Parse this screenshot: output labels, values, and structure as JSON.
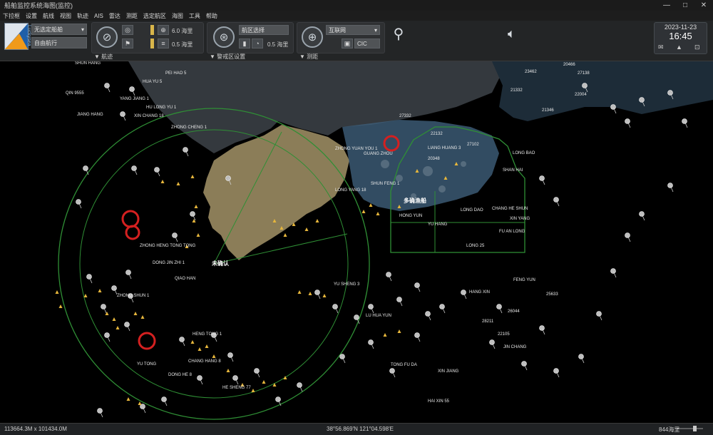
{
  "window": {
    "title": "船舶监控系统海图(监控)",
    "controls": [
      "—",
      "□",
      "✕"
    ]
  },
  "menu": [
    "下拉框",
    "设置",
    "航线",
    "视图",
    "轨迹",
    "AIS",
    "雷达",
    "测距",
    "选定航区",
    "海图",
    "工具",
    "帮助"
  ],
  "toolbar": {
    "logo_text": "Luckysea",
    "ship_select": "无选定船舶",
    "ship_select_sub": "自由航行",
    "group1_footer": "▼ 航迹",
    "radius_value": "6.0 海里",
    "radius_value2": "0.5 海里",
    "group2_footer": "▼ 警戒区设置",
    "range_value": "航区选择",
    "range_value2": "0.5 海里",
    "group3_footer": "▼ 测距",
    "layer_value": "互联网",
    "layer_value2": "CIC",
    "date": "2023-11-23",
    "time": "16:45",
    "icons": [
      "compass-icon",
      "radar-icon",
      "globe-icon",
      "speaker-icon",
      "mail-icon",
      "warning-icon",
      "lock-icon"
    ]
  },
  "map": {
    "places": [
      {
        "name": "未确认"
      },
      {
        "name": "多确渔船"
      }
    ],
    "labels": [
      "SHUN HANG",
      "PEI HAO 5",
      "HUA YU 5",
      "QIN 9555",
      "YANG JIANG 1",
      "HU LONG YU 1",
      "JIANG HANG",
      "XIN CHANG 18",
      "ZHONG CHENG 1",
      "ZHONG HENG TONG TONG",
      "DONG JIN ZHI 1",
      "QIAO HAN",
      "ZHONG SHUN 1",
      "HE SHENG 77",
      "CHANG HANG 8",
      "YU TONG",
      "DONG HE 8",
      "HENG TONG 1",
      "ZHONG YUAN YOU 1",
      "GUANG ZHOU",
      "LONG YANG 18",
      "SHUN FENG 1",
      "LIANG HUANG 3",
      "HONG YUN",
      "YU HANG",
      "LONG DAO",
      "CHANG HE SHUN",
      "FU AN LONG",
      "XIN YANG",
      "LONG BAO",
      "YU SHENG 3",
      "LU HUA YUN",
      "TONG FU DA",
      "HAI XIN 55",
      "HANG XIN",
      "XIN JIANG",
      "JIN CHANG",
      "SHAN HAI",
      "LONG 25",
      "FENG YUN"
    ],
    "mmsi": [
      "27332",
      "22132",
      "21332",
      "20466",
      "22004",
      "25633",
      "23462",
      "27138",
      "21346",
      "28211",
      "26044",
      "22105",
      "20348",
      "27102"
    ]
  },
  "status": {
    "scale": "113664.3M x 101434.0M",
    "position": "38°56.869'N  121°04.598'E",
    "zoom": "844海里"
  }
}
